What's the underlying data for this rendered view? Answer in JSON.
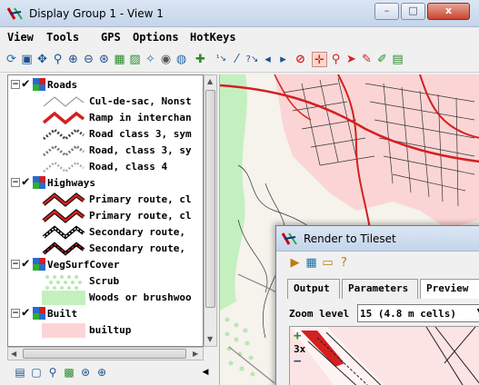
{
  "window": {
    "title": "Display Group 1 - View 1",
    "controls": {
      "minimize": "–",
      "maximize": "□",
      "close": "x"
    }
  },
  "menu": [
    "View",
    "Tools",
    "GPS",
    "Options",
    "HotKeys"
  ],
  "legend": {
    "groups": [
      {
        "name": "Roads",
        "layers": [
          {
            "label": "Cul-de-sac, Nonst",
            "swatch": "thin-gray"
          },
          {
            "label": "Ramp in interchan",
            "swatch": "red-thick"
          },
          {
            "label": "Road class 3, sym",
            "swatch": "dashed-dark"
          },
          {
            "label": "Road, class 3, sy",
            "swatch": "dashed-gray"
          },
          {
            "label": "Road, class 4",
            "swatch": "dashed-light"
          }
        ]
      },
      {
        "name": "Highways",
        "layers": [
          {
            "label": "Primary route, cl",
            "swatch": "red-cased"
          },
          {
            "label": "Primary route, cl",
            "swatch": "red-cased"
          },
          {
            "label": "Secondary route,",
            "swatch": "black-dashed"
          },
          {
            "label": "Secondary route,",
            "swatch": "red-black"
          }
        ]
      },
      {
        "name": "VegSurfCover",
        "layers": [
          {
            "label": "Scrub",
            "swatch": "green-dots"
          },
          {
            "label": "Woods or brushwoo",
            "swatch": "green-fill"
          }
        ]
      },
      {
        "name": "Built",
        "layers": [
          {
            "label": "builtup",
            "swatch": "pink-fill"
          }
        ]
      }
    ]
  },
  "dialog": {
    "title": "Render to Tileset",
    "tabs": [
      "Output",
      "Parameters",
      "Preview"
    ],
    "zoom_label": "Zoom level",
    "zoom_value": "15 (4.8 m cells)",
    "preview_zoom_text": "3x"
  },
  "colors": {
    "road_red": "#d42020",
    "veg_green": "#bfeebc",
    "built_pink": "#fbd5d5",
    "titlebar": "#c4d5ea"
  },
  "icons": [
    "app-icon",
    "gps-icon",
    "zoom-in-icon",
    "zoom-out-icon",
    "redraw-icon",
    "layer-controls-icon"
  ]
}
